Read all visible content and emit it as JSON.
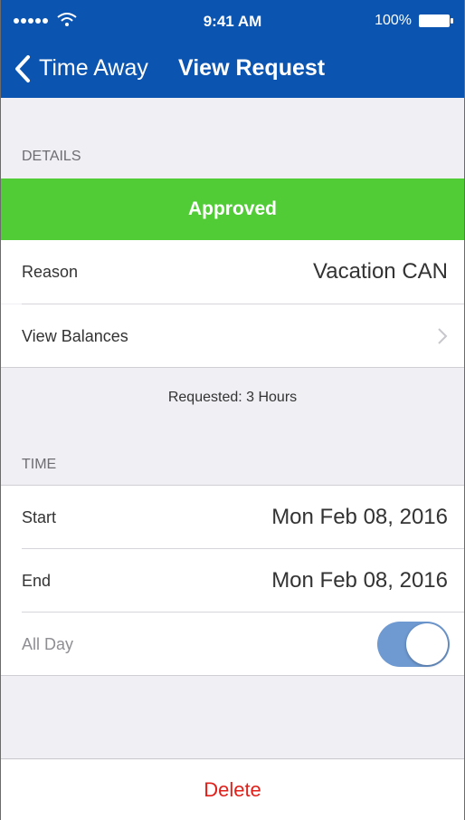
{
  "status_bar": {
    "time": "9:41 AM",
    "battery_percent": "100%",
    "signal_bars": 5
  },
  "nav": {
    "back_label": "Time Away",
    "title": "View Request"
  },
  "details": {
    "section_title": "DETAILS",
    "status": "Approved",
    "status_color": "#52cc36",
    "reason_label": "Reason",
    "reason_value": "Vacation CAN",
    "balances_label": "View Balances",
    "requested_text": "Requested: 3 Hours"
  },
  "time": {
    "section_title": "TIME",
    "start_label": "Start",
    "start_value": "Mon Feb 08, 2016",
    "end_label": "End",
    "end_value": "Mon Feb 08, 2016",
    "all_day_label": "All Day",
    "all_day_on": true
  },
  "actions": {
    "delete_label": "Delete",
    "delete_color": "#e0201a"
  },
  "colors": {
    "header": "#0b54b0",
    "background": "#efeff4"
  }
}
